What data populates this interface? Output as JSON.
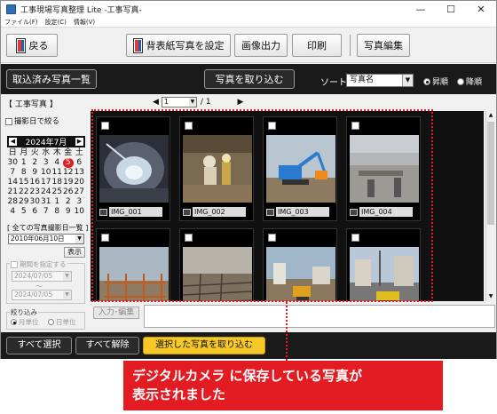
{
  "window": {
    "title": "工事現場写真整理 Lite -工事写真-"
  },
  "menu": [
    "ファイル(F)",
    "設定(C)",
    "情報(V)"
  ],
  "toolbar": {
    "back": "戻る",
    "set_cover": "背表紙写真を設定",
    "image_output": "画像出力",
    "print": "印刷",
    "photo_edit": "写真編集"
  },
  "blackbar": {
    "imported_list": "取込済み写真一覧",
    "import_photos": "写真を取り込む",
    "sort_label": "ソート",
    "sort_value": "写真名",
    "ascending": "昇順",
    "descending": "降順"
  },
  "section": {
    "label": "【 工事写真 】",
    "page_current": "1",
    "page_total": "/ 1"
  },
  "left": {
    "narrow_by_date": "撮影日で絞る",
    "calendar_month": "2024年7月",
    "weekdays": [
      "日",
      "月",
      "火",
      "水",
      "木",
      "金",
      "土"
    ],
    "days": [
      "30",
      "1",
      "2",
      "3",
      "4",
      "5",
      "6",
      "7",
      "8",
      "9",
      "10",
      "11",
      "12",
      "13",
      "14",
      "15",
      "16",
      "17",
      "18",
      "19",
      "20",
      "21",
      "22",
      "23",
      "24",
      "25",
      "26",
      "27",
      "28",
      "29",
      "30",
      "31",
      "1",
      "2",
      "3",
      "4",
      "5",
      "6",
      "7",
      "8",
      "9",
      "10"
    ],
    "selected_day_index": 5,
    "all_dates_label": "[ 全ての写真撮影日一覧 ]",
    "date_value": "2010年06月10日",
    "show": "表示",
    "period_label": "期間を指定する",
    "from_date": "2024/07/05",
    "tilde": "〜",
    "to_date": "2024/07/05",
    "narrowing": "絞り込み",
    "by_month": "月単位",
    "by_day": "日単位"
  },
  "photos": [
    {
      "name": "IMG_001",
      "scene": "tunnel"
    },
    {
      "name": "IMG_002",
      "scene": "digging"
    },
    {
      "name": "IMG_003",
      "scene": "excavator"
    },
    {
      "name": "IMG_004",
      "scene": "concrete"
    },
    {
      "name": "",
      "scene": "scaffold"
    },
    {
      "name": "",
      "scene": "rebar"
    },
    {
      "name": "",
      "scene": "site"
    },
    {
      "name": "",
      "scene": "street"
    }
  ],
  "input": {
    "label": "入力･編集"
  },
  "bottom": {
    "select_all": "すべて選択",
    "deselect_all": "すべて解除",
    "import_selected": "選択した写真を取り込む"
  },
  "callout": {
    "line1": "デジタルカメラ に保存している写真が",
    "line2": "表示されました"
  },
  "colors": {
    "accent_red": "#e31b23",
    "import_yellow": "#f6c928",
    "bar_black": "#1a1a1a"
  }
}
